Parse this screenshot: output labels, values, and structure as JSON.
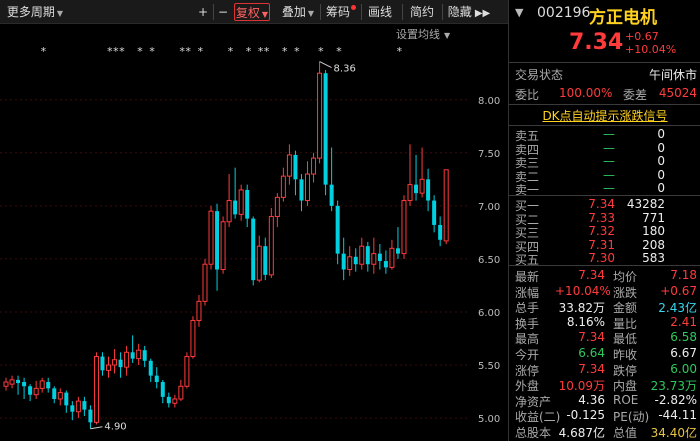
{
  "toolbar": {
    "period": "更多周期",
    "plus": "+",
    "minus": "−",
    "fuquan": "复权",
    "overlay": "叠加",
    "chips": "筹码",
    "draw": "画线",
    "simple": "简约",
    "hide": "隐藏"
  },
  "chart": {
    "ma_setting": "设置均线",
    "price_labels": [
      "8.00",
      "7.50",
      "7.00",
      "6.50",
      "6.00",
      "5.50",
      "5.00"
    ],
    "high_mark": "8.36",
    "low_mark": "4.90",
    "markers": "*",
    "colors": {
      "up": "#ff3b3b",
      "down": "#00d0e0",
      "grid": "#3a0c0c"
    }
  },
  "chart_data": {
    "type": "candlestick",
    "ylim": [
      4.85,
      8.45
    ],
    "candles": [
      {
        "o": 5.3,
        "c": 5.34,
        "h": 5.38,
        "l": 5.26
      },
      {
        "o": 5.32,
        "c": 5.36,
        "h": 5.4,
        "l": 5.28
      },
      {
        "o": 5.36,
        "c": 5.33,
        "h": 5.4,
        "l": 5.22
      },
      {
        "o": 5.34,
        "c": 5.3,
        "h": 5.38,
        "l": 5.18
      },
      {
        "o": 5.3,
        "c": 5.22,
        "h": 5.32,
        "l": 5.16
      },
      {
        "o": 5.22,
        "c": 5.28,
        "h": 5.35,
        "l": 5.18
      },
      {
        "o": 5.28,
        "c": 5.35,
        "h": 5.38,
        "l": 5.24
      },
      {
        "o": 5.34,
        "c": 5.28,
        "h": 5.38,
        "l": 5.24
      },
      {
        "o": 5.28,
        "c": 5.18,
        "h": 5.3,
        "l": 5.14
      },
      {
        "o": 5.18,
        "c": 5.24,
        "h": 5.28,
        "l": 5.12
      },
      {
        "o": 5.24,
        "c": 5.12,
        "h": 5.26,
        "l": 5.05
      },
      {
        "o": 5.12,
        "c": 5.06,
        "h": 5.16,
        "l": 4.98
      },
      {
        "o": 5.06,
        "c": 5.16,
        "h": 5.2,
        "l": 5.0
      },
      {
        "o": 5.16,
        "c": 5.08,
        "h": 5.2,
        "l": 5.02
      },
      {
        "o": 5.08,
        "c": 4.96,
        "h": 5.12,
        "l": 4.9
      },
      {
        "o": 4.96,
        "c": 5.58,
        "h": 5.62,
        "l": 4.94
      },
      {
        "o": 5.58,
        "c": 5.45,
        "h": 5.62,
        "l": 5.4
      },
      {
        "o": 5.45,
        "c": 5.5,
        "h": 5.58,
        "l": 5.38
      },
      {
        "o": 5.5,
        "c": 5.55,
        "h": 5.65,
        "l": 5.42
      },
      {
        "o": 5.55,
        "c": 5.48,
        "h": 5.62,
        "l": 5.38
      },
      {
        "o": 5.48,
        "c": 5.62,
        "h": 5.68,
        "l": 5.4
      },
      {
        "o": 5.62,
        "c": 5.56,
        "h": 5.78,
        "l": 5.52
      },
      {
        "o": 5.56,
        "c": 5.64,
        "h": 5.7,
        "l": 5.5
      },
      {
        "o": 5.64,
        "c": 5.54,
        "h": 5.68,
        "l": 5.48
      },
      {
        "o": 5.54,
        "c": 5.4,
        "h": 5.56,
        "l": 5.34
      },
      {
        "o": 5.4,
        "c": 5.34,
        "h": 5.48,
        "l": 5.28
      },
      {
        "o": 5.34,
        "c": 5.2,
        "h": 5.36,
        "l": 5.14
      },
      {
        "o": 5.2,
        "c": 5.14,
        "h": 5.24,
        "l": 5.1
      },
      {
        "o": 5.14,
        "c": 5.18,
        "h": 5.22,
        "l": 5.1
      },
      {
        "o": 5.18,
        "c": 5.3,
        "h": 5.36,
        "l": 5.16
      },
      {
        "o": 5.3,
        "c": 5.58,
        "h": 5.62,
        "l": 5.28
      },
      {
        "o": 5.58,
        "c": 5.92,
        "h": 5.96,
        "l": 5.56
      },
      {
        "o": 5.92,
        "c": 6.1,
        "h": 6.16,
        "l": 5.86
      },
      {
        "o": 6.1,
        "c": 6.45,
        "h": 6.5,
        "l": 6.06
      },
      {
        "o": 6.45,
        "c": 6.95,
        "h": 7.0,
        "l": 6.4
      },
      {
        "o": 6.95,
        "c": 6.4,
        "h": 7.02,
        "l": 6.2
      },
      {
        "o": 6.4,
        "c": 6.85,
        "h": 6.9,
        "l": 6.36
      },
      {
        "o": 6.85,
        "c": 7.05,
        "h": 7.3,
        "l": 6.8
      },
      {
        "o": 7.05,
        "c": 6.92,
        "h": 7.36,
        "l": 6.88
      },
      {
        "o": 6.92,
        "c": 7.15,
        "h": 7.2,
        "l": 6.86
      },
      {
        "o": 7.15,
        "c": 6.88,
        "h": 7.2,
        "l": 6.8
      },
      {
        "o": 6.88,
        "c": 6.3,
        "h": 6.9,
        "l": 6.25
      },
      {
        "o": 6.3,
        "c": 6.62,
        "h": 6.72,
        "l": 6.28
      },
      {
        "o": 6.62,
        "c": 6.35,
        "h": 6.7,
        "l": 6.3
      },
      {
        "o": 6.35,
        "c": 6.9,
        "h": 6.98,
        "l": 6.32
      },
      {
        "o": 6.9,
        "c": 7.08,
        "h": 7.12,
        "l": 6.8
      },
      {
        "o": 7.08,
        "c": 7.28,
        "h": 7.36,
        "l": 7.04
      },
      {
        "o": 7.28,
        "c": 7.48,
        "h": 7.58,
        "l": 7.2
      },
      {
        "o": 7.48,
        "c": 7.25,
        "h": 7.52,
        "l": 7.1
      },
      {
        "o": 7.25,
        "c": 7.05,
        "h": 7.3,
        "l": 6.95
      },
      {
        "o": 7.05,
        "c": 7.3,
        "h": 7.42,
        "l": 7.0
      },
      {
        "o": 7.3,
        "c": 7.45,
        "h": 7.5,
        "l": 7.22
      },
      {
        "o": 7.45,
        "c": 8.25,
        "h": 8.36,
        "l": 7.4
      },
      {
        "o": 8.25,
        "c": 7.2,
        "h": 8.28,
        "l": 7.1
      },
      {
        "o": 7.2,
        "c": 7.0,
        "h": 7.55,
        "l": 6.95
      },
      {
        "o": 7.0,
        "c": 6.55,
        "h": 7.05,
        "l": 6.45
      },
      {
        "o": 6.55,
        "c": 6.4,
        "h": 6.7,
        "l": 6.3
      },
      {
        "o": 6.4,
        "c": 6.52,
        "h": 6.62,
        "l": 6.34
      },
      {
        "o": 6.52,
        "c": 6.45,
        "h": 6.6,
        "l": 6.38
      },
      {
        "o": 6.45,
        "c": 6.62,
        "h": 6.7,
        "l": 6.4
      },
      {
        "o": 6.62,
        "c": 6.45,
        "h": 6.66,
        "l": 6.38
      },
      {
        "o": 6.45,
        "c": 6.55,
        "h": 6.7,
        "l": 6.36
      },
      {
        "o": 6.55,
        "c": 6.48,
        "h": 6.64,
        "l": 6.4
      },
      {
        "o": 6.48,
        "c": 6.42,
        "h": 6.58,
        "l": 6.36
      },
      {
        "o": 6.42,
        "c": 6.6,
        "h": 6.68,
        "l": 6.4
      },
      {
        "o": 6.6,
        "c": 6.55,
        "h": 6.8,
        "l": 6.5
      },
      {
        "o": 6.55,
        "c": 7.05,
        "h": 7.1,
        "l": 6.5
      },
      {
        "o": 7.05,
        "c": 7.2,
        "h": 7.58,
        "l": 7.0
      },
      {
        "o": 7.2,
        "c": 7.12,
        "h": 7.48,
        "l": 7.05
      },
      {
        "o": 7.12,
        "c": 7.25,
        "h": 7.55,
        "l": 7.08
      },
      {
        "o": 7.25,
        "c": 7.05,
        "h": 7.35,
        "l": 6.95
      },
      {
        "o": 7.05,
        "c": 6.82,
        "h": 7.1,
        "l": 6.75
      },
      {
        "o": 6.82,
        "c": 6.68,
        "h": 6.9,
        "l": 6.62
      },
      {
        "o": 6.67,
        "c": 7.34,
        "h": 7.34,
        "l": 6.64
      }
    ]
  },
  "stock": {
    "code": "002196",
    "name": "方正电机",
    "price": "7.34",
    "change": "+0.67",
    "change_pct": "+10.04%"
  },
  "status": {
    "label": "交易状态",
    "value": "午间休市"
  },
  "ratio": {
    "wb_label": "委比",
    "wb_value": "100.00%",
    "wc_label": "委差",
    "wc_value": "45024"
  },
  "dk_signal": "DK点自动提示涨跌信号",
  "sell": [
    {
      "label": "卖五",
      "price": "—",
      "vol": "0"
    },
    {
      "label": "卖四",
      "price": "—",
      "vol": "0"
    },
    {
      "label": "卖三",
      "price": "—",
      "vol": "0"
    },
    {
      "label": "卖二",
      "price": "—",
      "vol": "0"
    },
    {
      "label": "卖一",
      "price": "—",
      "vol": "0"
    }
  ],
  "buy": [
    {
      "label": "买一",
      "price": "7.34",
      "vol": "43282"
    },
    {
      "label": "买二",
      "price": "7.33",
      "vol": "771"
    },
    {
      "label": "买三",
      "price": "7.32",
      "vol": "180"
    },
    {
      "label": "买四",
      "price": "7.31",
      "vol": "208"
    },
    {
      "label": "买五",
      "price": "7.30",
      "vol": "583"
    }
  ],
  "stats": [
    {
      "l1": "最新",
      "v1": "7.34",
      "c1": "red",
      "l2": "均价",
      "v2": "7.18",
      "c2": "red"
    },
    {
      "l1": "涨幅",
      "v1": "+10.04%",
      "c1": "red",
      "l2": "涨跌",
      "v2": "+0.67",
      "c2": "red"
    },
    {
      "l1": "总手",
      "v1": "33.82万",
      "c1": "white",
      "l2": "金额",
      "v2": "2.43亿",
      "c2": "cyan"
    },
    {
      "l1": "换手",
      "v1": "8.16%",
      "c1": "white",
      "l2": "量比",
      "v2": "2.41",
      "c2": "red"
    },
    {
      "l1": "最高",
      "v1": "7.34",
      "c1": "red",
      "l2": "最低",
      "v2": "6.58",
      "c2": "green"
    },
    {
      "l1": "今开",
      "v1": "6.64",
      "c1": "green",
      "l2": "昨收",
      "v2": "6.67",
      "c2": "white"
    },
    {
      "l1": "涨停",
      "v1": "7.34",
      "c1": "red",
      "l2": "跌停",
      "v2": "6.00",
      "c2": "green"
    },
    {
      "l1": "外盘",
      "v1": "10.09万",
      "c1": "red",
      "l2": "内盘",
      "v2": "23.73万",
      "c2": "green"
    },
    {
      "l1": "净资产",
      "v1": "4.36",
      "c1": "white",
      "l2": "ROE",
      "v2": "-2.82%",
      "c2": "white"
    },
    {
      "l1": "收益(二)",
      "v1": "-0.125",
      "c1": "white",
      "l2": "PE(动)",
      "v2": "-44.11",
      "c2": "white"
    },
    {
      "l1": "总股本",
      "v1": "4.687亿",
      "c1": "white",
      "l2": "总值",
      "v2": "34.40亿",
      "c2": "yellow"
    }
  ]
}
